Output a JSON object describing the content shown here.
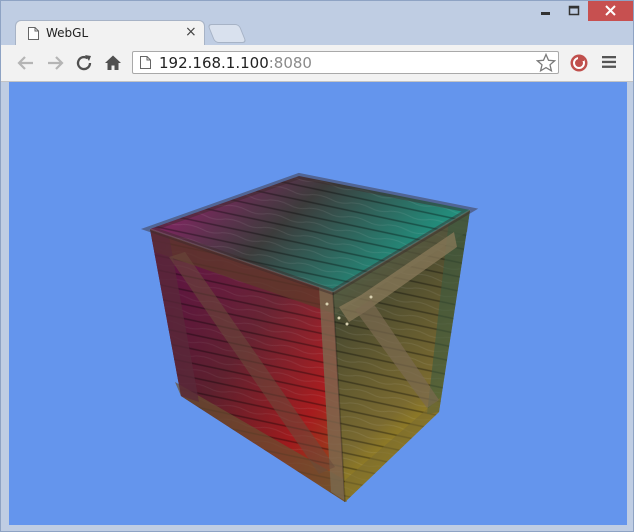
{
  "tab": {
    "title": "WebGL",
    "close_glyph": "×"
  },
  "address_bar": {
    "host": "192.168.1.100",
    "port": ":8080"
  },
  "window_controls": [
    "minimize-icon",
    "maximize-icon",
    "close-icon"
  ],
  "toolbar_icons": [
    "back-arrow-icon",
    "forward-arrow-icon",
    "reload-icon",
    "home-icon",
    "page-icon",
    "bookmark-star-icon",
    "extension-icon",
    "menu-icon"
  ],
  "colors": {
    "canvas_background": "#6495ed",
    "close_button": "#c75050",
    "chrome_frame": "#bfcde3",
    "toolbar": "#f2f2f2"
  },
  "scene": {
    "object": "wooden-crate-cube"
  }
}
